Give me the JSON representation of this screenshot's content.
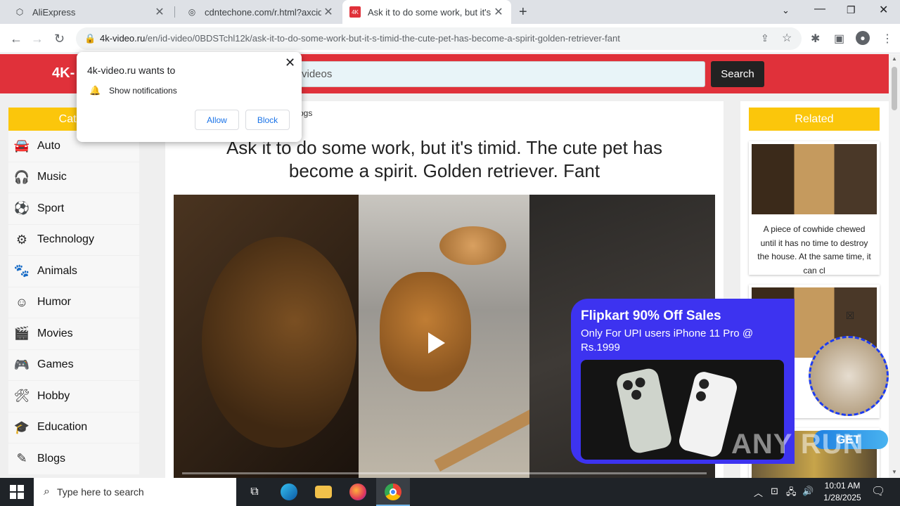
{
  "tabs": [
    {
      "title": "AliExpress",
      "icon": "aliexpress-icon"
    },
    {
      "title": "cdntechone.com/r.html?axcid=",
      "icon": "globe-icon"
    },
    {
      "title": "Ask it to do some work, but it's t",
      "icon": "4k-video-icon"
    }
  ],
  "address_bar": {
    "host": "4k-video.ru",
    "path": "/en/id-video/0BDSTchl12k/ask-it-to-do-some-work-but-it-s-timid-the-cute-pet-has-become-a-spirit-golden-retriever-fant"
  },
  "site": {
    "logo": "4K-",
    "search_placeholder": "videos",
    "search_button": "Search"
  },
  "categories": {
    "heading": "Categ",
    "items": [
      {
        "label": "Auto",
        "icon": "car-icon"
      },
      {
        "label": "Music",
        "icon": "headphones-icon"
      },
      {
        "label": "Sport",
        "icon": "soccer-ball-icon"
      },
      {
        "label": "Technology",
        "icon": "technology-icon"
      },
      {
        "label": "Animals",
        "icon": "paw-icon"
      },
      {
        "label": "Humor",
        "icon": "smile-icon"
      },
      {
        "label": "Movies",
        "icon": "clapperboard-icon"
      },
      {
        "label": "Games",
        "icon": "gamepad-icon"
      },
      {
        "label": "Hobby",
        "icon": "tools-icon"
      },
      {
        "label": "Education",
        "icon": "graduation-cap-icon"
      },
      {
        "label": "Blogs",
        "icon": "blogger-icon"
      }
    ]
  },
  "main": {
    "breadcrumb": "ogs",
    "title": "Ask it to do some work, but it's timid. The cute pet has become a spirit. Golden retriever. Fant"
  },
  "related": {
    "heading": "Related",
    "cards": [
      {
        "text": "A piece of cowhide chewed until it has no time to destroy the house. At the same time, it can cl"
      }
    ]
  },
  "notification_popup": {
    "title": "4k-video.ru wants to",
    "permission": "Show notifications",
    "allow": "Allow",
    "block": "Block"
  },
  "ad": {
    "headline": "Flipkart 90% Off Sales",
    "subtext": "Only For UPI users iPhone 11 Pro @ Rs.1999",
    "cta": "GET",
    "watermark": "ANY RUN",
    "colors": {
      "background": "#3d33f0",
      "cta": "#1f7fe0"
    }
  },
  "taskbar": {
    "search_placeholder": "Type here to search",
    "time": "10:01 AM",
    "date": "1/28/2025"
  },
  "colors": {
    "header": "#e0313a",
    "category_heading": "#fbc60b"
  }
}
